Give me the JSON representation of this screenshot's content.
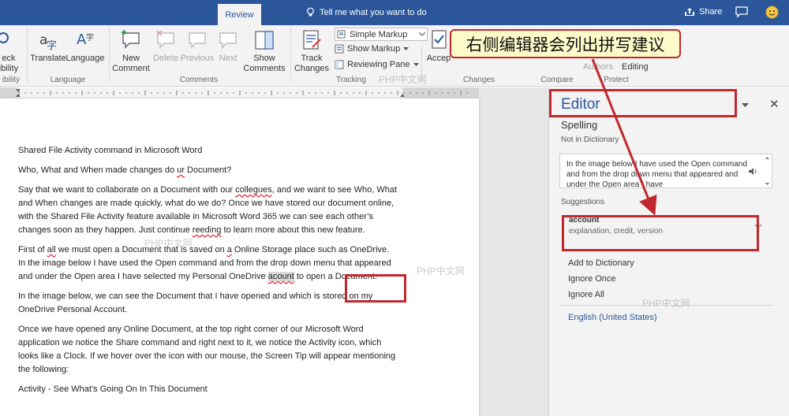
{
  "tabs": {
    "review": "Review"
  },
  "tell_me": "Tell me what you want to do",
  "share": "Share",
  "ribbon": {
    "proofing_partial": {
      "label_a": "eck",
      "label_b": "ibility",
      "group": "ibility"
    },
    "translate": "Translate",
    "language_btn": "Language",
    "group_language": "Language",
    "new_comment": [
      "New",
      "Comment"
    ],
    "delete": "Delete",
    "previous": "Previous",
    "next": "Next",
    "show_comments": [
      "Show",
      "Comments"
    ],
    "group_comments": "Comments",
    "track_changes": [
      "Track",
      "Changes"
    ],
    "markup_select": "Simple Markup",
    "show_markup": "Show Markup",
    "reviewing_pane": "Reviewing Pane",
    "group_tracking": "Tracking",
    "accept": "Accep",
    "group_changes": "Changes",
    "group_compare": "Compare",
    "authors": "Authors",
    "editing": "Editing",
    "group_protect": "Protect"
  },
  "callout_text": "右侧编辑器会列出拼写建议",
  "document": {
    "title_line": "Shared File Activity command in Microsoft Word",
    "line2": [
      "Who, What and When made changes do ",
      "ur",
      " Document?"
    ],
    "para1": [
      "Say that we want to collaborate on a Document with our ",
      "collegues",
      ", and we want to see Who, What and When changes are made quickly, what do we do?  Once we have stored our document online, with the Shared File Activity feature available in Microsoft Word 365 we can see each other’s changes soon as they happen.  Just continue ",
      "reeding",
      " to learn more about this new feature."
    ],
    "para2": [
      "First of ",
      "all",
      " we must open a Document that is saved on ",
      "a",
      " Online Storage place such as OneDrive.  In the image below I have used the Open command and from the drop down menu that appeared and under the Open area I have selected my Personal OneDrive ",
      "acount",
      " to open a Document."
    ],
    "para3": " In the image below, we can see the Document that I have opened and which is stored on my OneDrive Personal Account.",
    "para4": " Once we have opened any Online Document, at the top right corner of our Microsoft Word application we notice the Share command and right next to it, we notice the Activity icon, which looks like a Clock.  If we hover over the icon with our mouse, the Screen Tip will appear mentioning the following:",
    "para5": "Activity - See What’s Going On In This Document"
  },
  "editor": {
    "title": "Editor",
    "section": "Spelling",
    "sub": "Not in Dictionary",
    "context": "In the image below I have used the Open command and from the drop down menu that appeared and under the Open area I have",
    "suggestions_label": "Suggestions",
    "suggestion_word": "account",
    "suggestion_synonyms": "explanation, credit, version",
    "add_to_dictionary": "Add to Dictionary",
    "ignore_once": "Ignore Once",
    "ignore_all": "Ignore All",
    "language": "English (United States)"
  },
  "watermark": "PHP中文网",
  "colors": {
    "brand": "#2b579a",
    "annotation": "#c0282d",
    "callout_bg": "#fdfac9"
  }
}
